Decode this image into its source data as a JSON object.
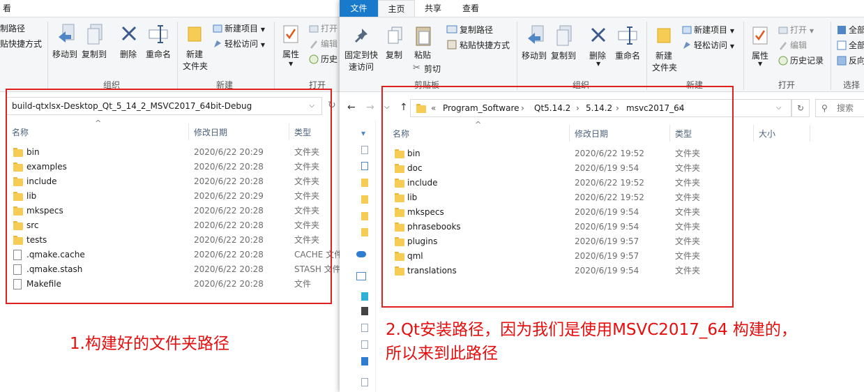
{
  "left_window": {
    "tab_partial": "看",
    "ribbon": {
      "copy_path": "制路径",
      "paste_shortcut": "贴快捷方式",
      "move_to": "移动到",
      "copy_to": "复制到",
      "delete": "删除",
      "rename": "重命名",
      "new_folder_line1": "新建",
      "new_folder_line2": "文件夹",
      "new_item": "新建项目",
      "easy_access": "轻松访问",
      "properties": "属性",
      "open": "打开",
      "edit": "编辑",
      "history": "历史",
      "group_organize": "组织",
      "group_new": "新建",
      "group_open": "打开"
    },
    "address": "build-qtxlsx-Desktop_Qt_5_14_2_MSVC2017_64bit-Debug",
    "columns": {
      "name": "名称",
      "date": "修改日期",
      "type": "类型"
    },
    "rows": [
      {
        "name": "bin",
        "date": "2020/6/22 20:29",
        "type": "文件夹",
        "icon": "folder"
      },
      {
        "name": "examples",
        "date": "2020/6/22 20:28",
        "type": "文件夹",
        "icon": "folder"
      },
      {
        "name": "include",
        "date": "2020/6/22 20:28",
        "type": "文件夹",
        "icon": "folder"
      },
      {
        "name": "lib",
        "date": "2020/6/22 20:29",
        "type": "文件夹",
        "icon": "folder"
      },
      {
        "name": "mkspecs",
        "date": "2020/6/22 20:28",
        "type": "文件夹",
        "icon": "folder"
      },
      {
        "name": "src",
        "date": "2020/6/22 20:28",
        "type": "文件夹",
        "icon": "folder"
      },
      {
        "name": "tests",
        "date": "2020/6/22 20:28",
        "type": "文件夹",
        "icon": "folder"
      },
      {
        "name": ".qmake.cache",
        "date": "2020/6/22 20:28",
        "type": "CACHE 文件",
        "icon": "file"
      },
      {
        "name": ".qmake.stash",
        "date": "2020/6/22 20:28",
        "type": "STASH 文件",
        "icon": "file"
      },
      {
        "name": "Makefile",
        "date": "2020/6/22 20:28",
        "type": "文件",
        "icon": "file"
      }
    ],
    "annotation": "1.构建好的文件夹路径"
  },
  "right_window": {
    "tabs": {
      "file": "文件",
      "home": "主页",
      "share": "共享",
      "view": "查看"
    },
    "ribbon": {
      "pin_line1": "固定到快",
      "pin_line2": "速访问",
      "copy": "复制",
      "paste": "粘贴",
      "copy_path": "复制路径",
      "paste_shortcut": "粘贴快捷方式",
      "cut": "剪切",
      "move_to": "移动到",
      "copy_to": "复制到",
      "delete": "删除",
      "rename": "重命名",
      "new_folder_line1": "新建",
      "new_folder_line2": "文件夹",
      "new_item": "新建项目",
      "easy_access": "轻松访问",
      "properties": "属性",
      "open": "打开",
      "edit": "编辑",
      "history": "历史记录",
      "select_all": "全部",
      "select_none": "全部",
      "invert": "反向",
      "group_clipboard": "剪贴板",
      "group_organize": "组织",
      "group_new": "新建",
      "group_open": "打开",
      "group_select": "选择"
    },
    "breadcrumb": [
      "Program_Software",
      "Qt5.14.2",
      "5.14.2",
      "msvc2017_64"
    ],
    "search_placeholder": "搜索",
    "columns": {
      "name": "名称",
      "date": "修改日期",
      "type": "类型",
      "size": "大小"
    },
    "rows": [
      {
        "name": "bin",
        "date": "2020/6/22 19:52",
        "type": "文件夹"
      },
      {
        "name": "doc",
        "date": "2020/6/19 9:54",
        "type": "文件夹"
      },
      {
        "name": "include",
        "date": "2020/6/22 19:52",
        "type": "文件夹"
      },
      {
        "name": "lib",
        "date": "2020/6/22 19:52",
        "type": "文件夹"
      },
      {
        "name": "mkspecs",
        "date": "2020/6/19 9:54",
        "type": "文件夹"
      },
      {
        "name": "phrasebooks",
        "date": "2020/6/19 9:54",
        "type": "文件夹"
      },
      {
        "name": "plugins",
        "date": "2020/6/19 9:57",
        "type": "文件夹"
      },
      {
        "name": "qml",
        "date": "2020/6/19 9:57",
        "type": "文件夹"
      },
      {
        "name": "translations",
        "date": "2020/6/19 9:54",
        "type": "文件夹"
      }
    ],
    "annotation_line1": "2.Qt安装路径，因为我们是使用MSVC2017_64 构建的，",
    "annotation_line2": "所以来到此路径"
  },
  "colors": {
    "file_tab": "#1979ca",
    "annotation": "#e60d0d",
    "folder": "#f6cc55"
  }
}
